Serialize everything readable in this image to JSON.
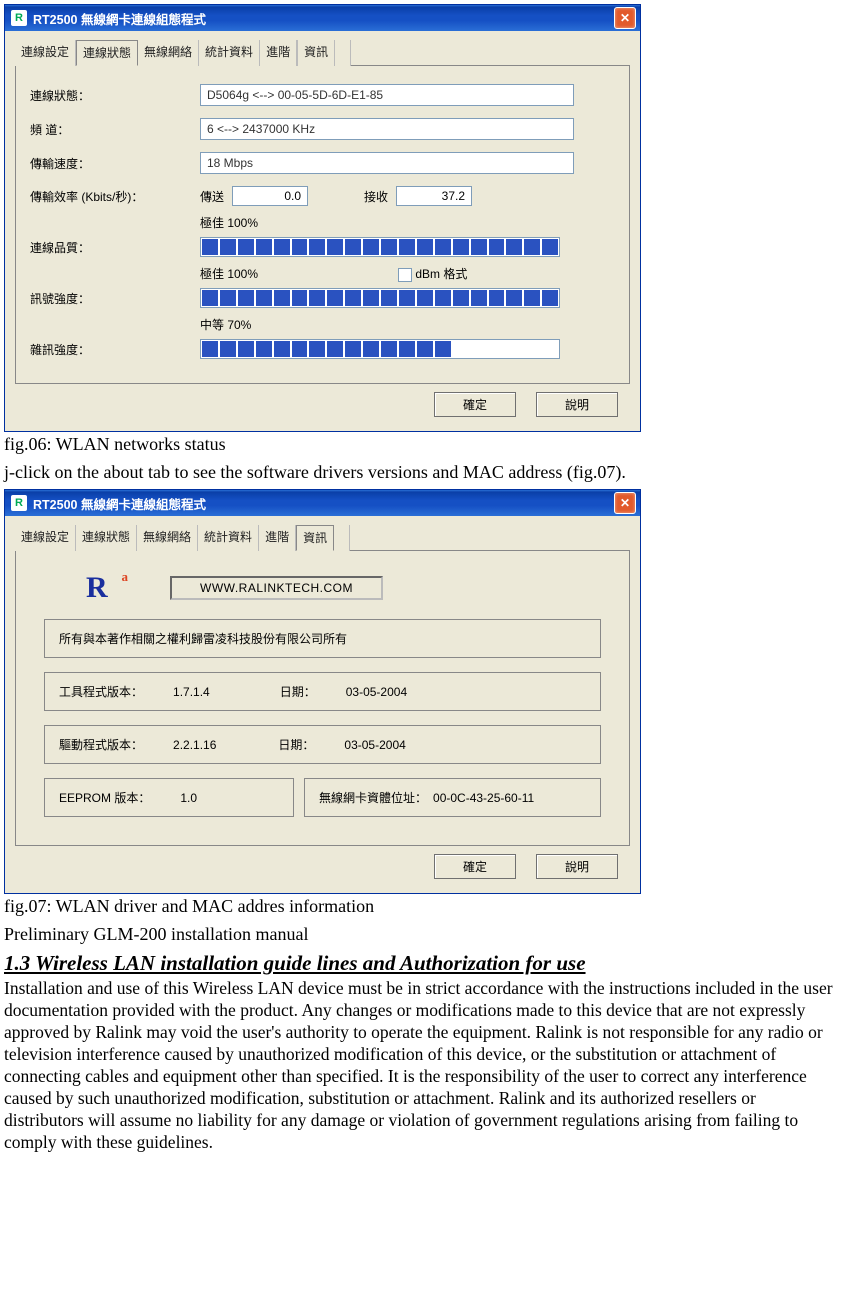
{
  "fig06": {
    "title": "RT2500 無線網卡連線組態程式",
    "tabs": [
      "連線設定",
      "連線狀態",
      "無線網絡",
      "統計資料",
      "進階",
      "資訊"
    ],
    "active_tab": 1,
    "labels": {
      "status": "連線狀態：",
      "channel": "頻    道：",
      "speed": "傳輸速度：",
      "throughput": "傳輸效率 (Kbits/秒)：",
      "tx": "傳送",
      "rx": "接收",
      "quality_caption": "極佳    100%",
      "quality": "連線品質：",
      "signal_caption": "極佳    100%",
      "dbm": "dBm 格式",
      "signal": "訊號強度：",
      "noise_caption": "中等    70%",
      "noise": "雜訊強度："
    },
    "values": {
      "status": "D5064g <--> 00-05-5D-6D-E1-85",
      "channel": "6 <--> 2437000 KHz",
      "speed": "18 Mbps",
      "tx": "0.0",
      "rx": "37.2"
    },
    "bars": {
      "quality_pct": 100,
      "signal_pct": 100,
      "noise_pct": 70
    },
    "buttons": {
      "ok": "確定",
      "help": "說明"
    }
  },
  "caption06": "fig.06: WLAN networks status",
  "instr_j": "j-click on the about tab to see the software drivers versions and MAC address (fig.07).",
  "fig07": {
    "title": "RT2500 無線網卡連線組態程式",
    "tabs": [
      "連線設定",
      "連線狀態",
      "無線網絡",
      "統計資料",
      "進階",
      "資訊"
    ],
    "active_tab": 5,
    "url": "WWW.RALINKTECH.COM",
    "copyright": "所有與本著作相關之權利歸雷凌科技股份有限公司所有",
    "tool_ver_label": "工具程式版本：",
    "tool_ver": "1.7.1.4",
    "date_label": "日期：",
    "tool_date": "03-05-2004",
    "drv_ver_label": "驅動程式版本：",
    "drv_ver": "2.2.1.16",
    "drv_date": "03-05-2004",
    "eeprom_label": "EEPROM 版本：",
    "eeprom_ver": "1.0",
    "mac_label": "無線網卡資體位址：",
    "mac": "00-0C-43-25-60-11",
    "buttons": {
      "ok": "確定",
      "help": "說明"
    }
  },
  "caption07": "fig.07: WLAN driver and MAC addres information",
  "manual_title": "Preliminary GLM-200 installation manual",
  "section_header": "1.3 Wireless LAN installation guide lines and Authorization for use",
  "section_body": "Installation and use of this Wireless LAN device must be in strict accordance with the instructions included in the user documentation provided with the product. Any changes or modifications made to this device that are not expressly approved by Ralink may void the user's authority to operate the equipment. Ralink is not responsible for any radio or television interference caused by unauthorized modification of this device, or the substitution or attachment of connecting cables and equipment other than specified. It is the responsibility of the user to correct any interference caused by such unauthorized modification, substitution or attachment. Ralink and its authorized resellers or distributors will assume no liability for any damage or violation of government regulations arising from failing to comply with these guidelines."
}
